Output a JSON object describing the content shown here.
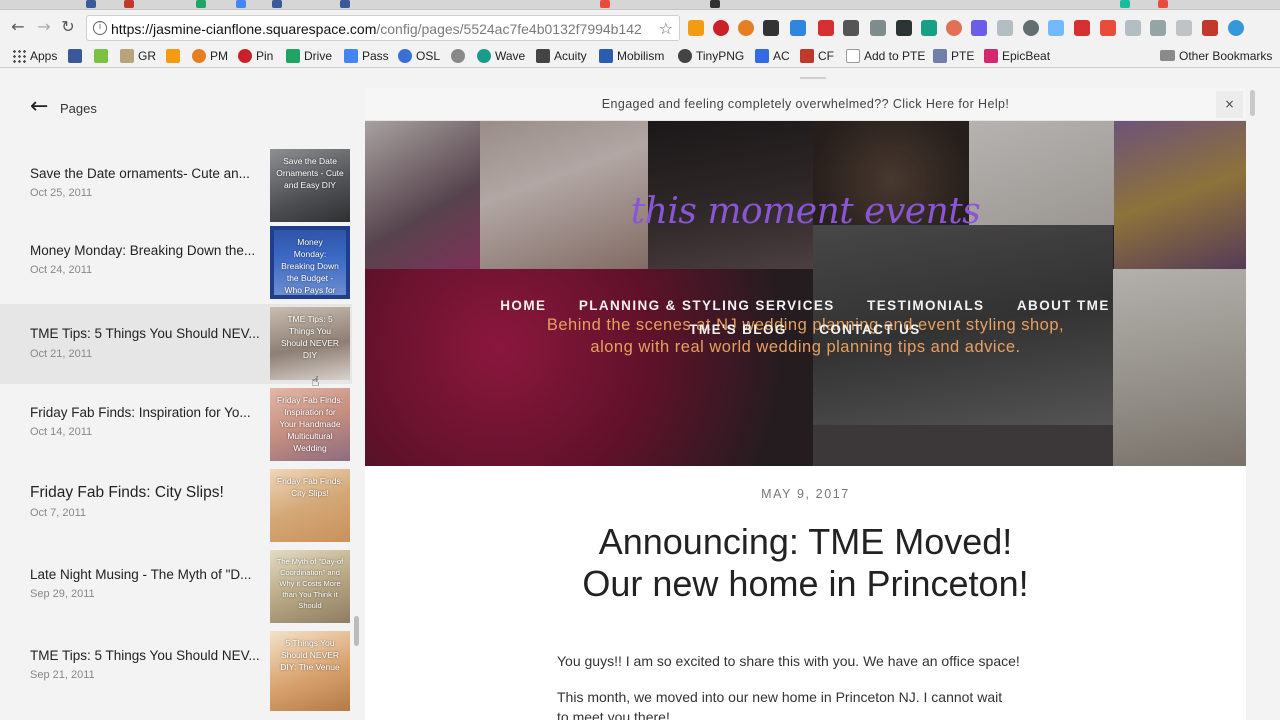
{
  "browser": {
    "url_host": "https://jasmine-cianflone.squarespace.com",
    "url_path": "/config/pages/5524ac7fe4b0132f7994b142",
    "bookmarks": [
      {
        "label": "Apps",
        "icon": "apps-grid-icon",
        "color": "#555555"
      },
      {
        "label": "",
        "icon": "facebook-icon",
        "color": "#3b5998"
      },
      {
        "label": "",
        "icon": "houzz-icon",
        "color": "#7ac142"
      },
      {
        "label": "GR",
        "icon": "goodreads-icon",
        "color": "#b8a47a"
      },
      {
        "label": "",
        "icon": "amazon-icon",
        "color": "#f39c12"
      },
      {
        "label": "PM",
        "icon": "pm-icon",
        "color": "#e67e22"
      },
      {
        "label": "Pin",
        "icon": "pinterest-icon",
        "color": "#cb2027"
      },
      {
        "label": "Drive",
        "icon": "drive-icon",
        "color": "#1fa463"
      },
      {
        "label": "Pass",
        "icon": "docs-icon",
        "color": "#4285f4"
      },
      {
        "label": "OSL",
        "icon": "osl-icon",
        "color": "#3b6fd6"
      },
      {
        "label": "",
        "icon": "reddit-icon",
        "color": "#888888"
      },
      {
        "label": "Wave",
        "icon": "wave-icon",
        "color": "#1a9c8c"
      },
      {
        "label": "Acuity",
        "icon": "acuity-icon",
        "color": "#444444"
      },
      {
        "label": "Mobilism",
        "icon": "mobilism-icon",
        "color": "#2a5db0"
      },
      {
        "label": "TinyPNG",
        "icon": "panda-icon",
        "color": "#444444"
      },
      {
        "label": "AC",
        "icon": "activecampaign-icon",
        "color": "#356ae6"
      },
      {
        "label": "CF",
        "icon": "cf-icon",
        "color": "#c0392b"
      },
      {
        "label": "Add to PTE",
        "icon": "page-icon",
        "color": "#999999"
      },
      {
        "label": "PTE",
        "icon": "pte-icon",
        "color": "#6f7fa8"
      },
      {
        "label": "EpicBeat",
        "icon": "epicbeat-icon",
        "color": "#d6286c"
      }
    ],
    "other_bookmarks": "Other Bookmarks"
  },
  "sidebar": {
    "title": "Pages",
    "items": [
      {
        "title": "Save the Date ornaments- Cute an...",
        "date": "Oct 25, 2011",
        "thumb_text": "Save the Date Ornaments - Cute and Easy DIY",
        "thumb_color": "#6d6f73"
      },
      {
        "title": "Money Monday: Breaking Down the...",
        "date": "Oct 24, 2011",
        "thumb_text": "Money Monday: Breaking Down the Budget - Who Pays for What?",
        "thumb_color": "#3a5fb0"
      },
      {
        "title": "TME Tips: 5 Things You Should NEV...",
        "date": "Oct 21, 2011",
        "thumb_text": "TME Tips: 5 Things You Should NEVER DIY",
        "thumb_color": "#9b8f86"
      },
      {
        "title": "Friday Fab Finds: Inspiration for Yo...",
        "date": "Oct 14, 2011",
        "thumb_text": "Friday Fab Finds: Inspiration for Your Handmade Multicultural Wedding",
        "thumb_color": "#c89a8e"
      },
      {
        "title": "Friday Fab Finds: City Slips!",
        "date": "Oct 7, 2011",
        "thumb_text": "Friday Fab Finds: City Slips!",
        "thumb_color": "#d9b58a"
      },
      {
        "title": "Late Night Musing - The Myth of \"D...",
        "date": "Sep 29, 2011",
        "thumb_text": "The Myth of \"Day-of Coordination\" and Why it Costs More than You Think it Should",
        "thumb_color": "#c7b99a"
      },
      {
        "title": "TME Tips: 5 Things You Should NEV...",
        "date": "Sep 21, 2011",
        "thumb_text": "5 Things You Should NEVER DIY: The Venue",
        "thumb_color": "#d1a679"
      }
    ]
  },
  "site": {
    "announcement": "Engaged and feeling completely overwhelmed?? Click Here for Help!",
    "close_label": "×",
    "title": "this moment events",
    "title_color": "#8a55d6",
    "nav": [
      "HOME",
      "PLANNING & STYLING SERVICES",
      "TESTIMONIALS",
      "ABOUT TME",
      "TME'S BLOG",
      "CONTACT US"
    ],
    "tagline_line1": "Behind the scenes at NJ wedding planning and event styling shop,",
    "tagline_line2": "along with real world wedding planning tips and advice.",
    "tagline_color": "#e6a060"
  },
  "post": {
    "date": "MAY 9, 2017",
    "title_line1": "Announcing: TME Moved!",
    "title_line2": "Our new home in Princeton!",
    "p1": "You guys!! I am so excited to share this with you. We have an office space!",
    "p2": "This month, we moved into our new home in Princeton NJ. I cannot wait",
    "p3": "to meet you there!"
  }
}
